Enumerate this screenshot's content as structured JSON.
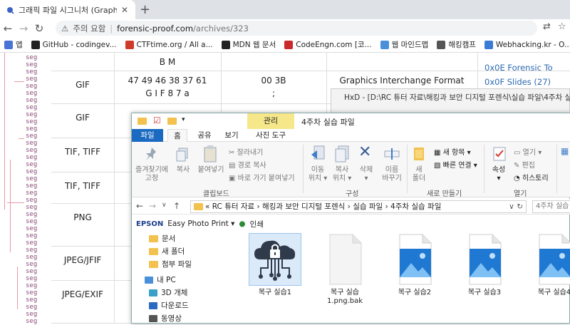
{
  "browser": {
    "tab_title": "그래픽 파일 시그니처 (Graphic F",
    "omnibox": {
      "warning": "주의 요함",
      "url_host": "forensic-proof.com",
      "url_path": "/archives/323"
    }
  },
  "bookmarks": [
    {
      "label": "앱",
      "color": "#4a73d6"
    },
    {
      "label": "GitHub - codingev...",
      "color": "#222222"
    },
    {
      "label": "CTFtime.org / All a...",
      "color": "#d03a2a"
    },
    {
      "label": "MDN 웹 문서",
      "color": "#222222"
    },
    {
      "label": "CodeEngn.com [코...",
      "color": "#c92a2a"
    },
    {
      "label": "웹 마인드맵",
      "color": "#4a90d9"
    },
    {
      "label": "해킹캠프",
      "color": "#555555"
    },
    {
      "label": "Webhacking.kr - O...",
      "color": "#3a7bd5"
    }
  ],
  "page": {
    "seg_label": "seg",
    "rows": [
      {
        "format": "",
        "hex": "B M",
        "hex2": "",
        "trailer": "",
        "trailer2": "",
        "desc": ""
      },
      {
        "format": "GIF",
        "hex": "47 49 46 38 37 61",
        "hex2": "G I F 8 7 a",
        "trailer": "00 3B",
        "trailer2": ";",
        "desc": "Graphics Interchange Format"
      },
      {
        "format": "GIF",
        "hex": "",
        "hex2": "",
        "trailer": "",
        "trailer2": "",
        "desc": ""
      },
      {
        "format": "TIF, TIFF",
        "hex": "",
        "hex2": "",
        "trailer": "",
        "trailer2": "",
        "desc": ""
      },
      {
        "format": "TIF, TIFF",
        "hex": "",
        "hex2": "",
        "trailer": "",
        "trailer2": "",
        "desc": ""
      },
      {
        "format": "PNG",
        "hex": "8",
        "hex2": "",
        "trailer": "",
        "trailer2": "",
        "desc": ""
      },
      {
        "format": "JPEG/JFIF",
        "hex": "",
        "hex2": "",
        "trailer": "",
        "trailer2": "",
        "desc": ""
      },
      {
        "format": "JPEG/EXIF",
        "hex": "",
        "hex2": "",
        "trailer": "",
        "trailer2": "",
        "desc": ""
      }
    ],
    "right_links": [
      "0x0E Forensic To",
      "0x0F Slides (27)"
    ]
  },
  "hxd": {
    "title": "HxD - [D:\\RC 튜터 자료\\해킹과 보안 디지털 포렌식\\실습 파일\\4주차 실"
  },
  "explorer": {
    "manage_label": "관리",
    "window_title": "4주차 실습 파일",
    "tabs": {
      "file": "파일",
      "home": "홈",
      "share": "공유",
      "view": "보기",
      "picture_tools": "사진 도구"
    },
    "ribbon": {
      "pin": "즐겨찾기에\n고정",
      "copy": "복사",
      "paste": "붙여넣기",
      "cut": "잘라내기",
      "copy_path": "경로 복사",
      "paste_shortcut": "바로 가기 붙여넣기",
      "clipboard": "클립보드",
      "move_to": "이동\n위치 ▾",
      "copy_to": "복사\n위치 ▾",
      "delete": "삭제\n▾",
      "rename": "이름\n바꾸기",
      "organize": "구성",
      "new_folder": "새\n폴더",
      "new_item": "새 항목 ▾",
      "easy_access": "빠른 연결 ▾",
      "new": "새로 만들기",
      "properties": "속성\n▾",
      "open": "열기 ▾",
      "edit": "편집",
      "history": "히스토리",
      "open_group": "열기"
    },
    "address": {
      "path": "«  RC 튜터 자료  ›  해킹과 보안 디지털 포렌식  ›  실습 파일  ›  4주차 실습 파일",
      "search_placeholder": "4주차 실습"
    },
    "epson": {
      "brand": "EPSON",
      "app": "Easy Photo Print ▾",
      "print": "인쇄"
    },
    "nav": [
      {
        "label": "문서",
        "type": "folder"
      },
      {
        "label": "새 폴더",
        "type": "folder"
      },
      {
        "label": "첨부 파일",
        "type": "folder"
      },
      {
        "label": "내 PC",
        "type": "pc"
      },
      {
        "label": "3D 개체",
        "type": "3d"
      },
      {
        "label": "다운로드",
        "type": "download"
      },
      {
        "label": "동영상",
        "type": "video"
      }
    ],
    "files": [
      {
        "name": "복구 실습1",
        "type": "cloud-lock",
        "selected": true
      },
      {
        "name": "복구 실습\n1.png.bak",
        "type": "blank",
        "selected": false
      },
      {
        "name": "복구 실습2",
        "type": "image",
        "selected": false
      },
      {
        "name": "복구 실습3",
        "type": "image",
        "selected": false
      },
      {
        "name": "복구 실습4",
        "type": "image",
        "selected": false
      }
    ]
  }
}
